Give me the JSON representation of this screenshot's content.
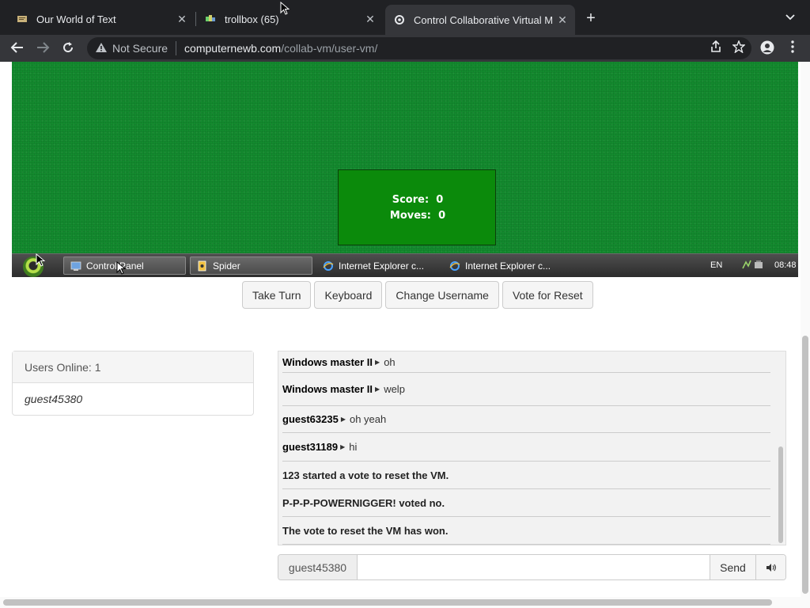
{
  "browser": {
    "tabs": [
      {
        "title": "Our World of Text",
        "active": false
      },
      {
        "title": "trollbox (65)",
        "active": false
      },
      {
        "title": "Control Collaborative Virtual M",
        "active": true
      }
    ],
    "security_label": "Not Secure",
    "url_host": "computernewb.com",
    "url_path": "/collab-vm/user-vm/"
  },
  "vm": {
    "score_label": "Score:",
    "score_value": "0",
    "moves_label": "Moves:",
    "moves_value": "0",
    "taskbar": {
      "items": [
        "Control Panel",
        "Spider",
        "Internet Explorer c...",
        "Internet Explorer c..."
      ],
      "lang": "EN",
      "clock": "08:48"
    }
  },
  "controls": {
    "take_turn": "Take Turn",
    "keyboard": "Keyboard",
    "change_username": "Change Username",
    "vote_reset": "Vote for Reset"
  },
  "users": {
    "header": "Users Online: 1",
    "list": [
      "guest45380"
    ]
  },
  "chat": {
    "messages": [
      {
        "user": "Windows master II",
        "text": "oh"
      },
      {
        "user": "Windows master II",
        "text": "welp"
      },
      {
        "user": "guest63235",
        "text": "oh yeah"
      },
      {
        "user": "guest31189",
        "text": "hi"
      },
      {
        "system": "123 started a vote to reset the VM."
      },
      {
        "system": "P-P-P-POWERNIGGER! voted no."
      },
      {
        "system": "The vote to reset the VM has won."
      }
    ],
    "username": "guest45380",
    "input_value": "",
    "send_label": "Send"
  }
}
